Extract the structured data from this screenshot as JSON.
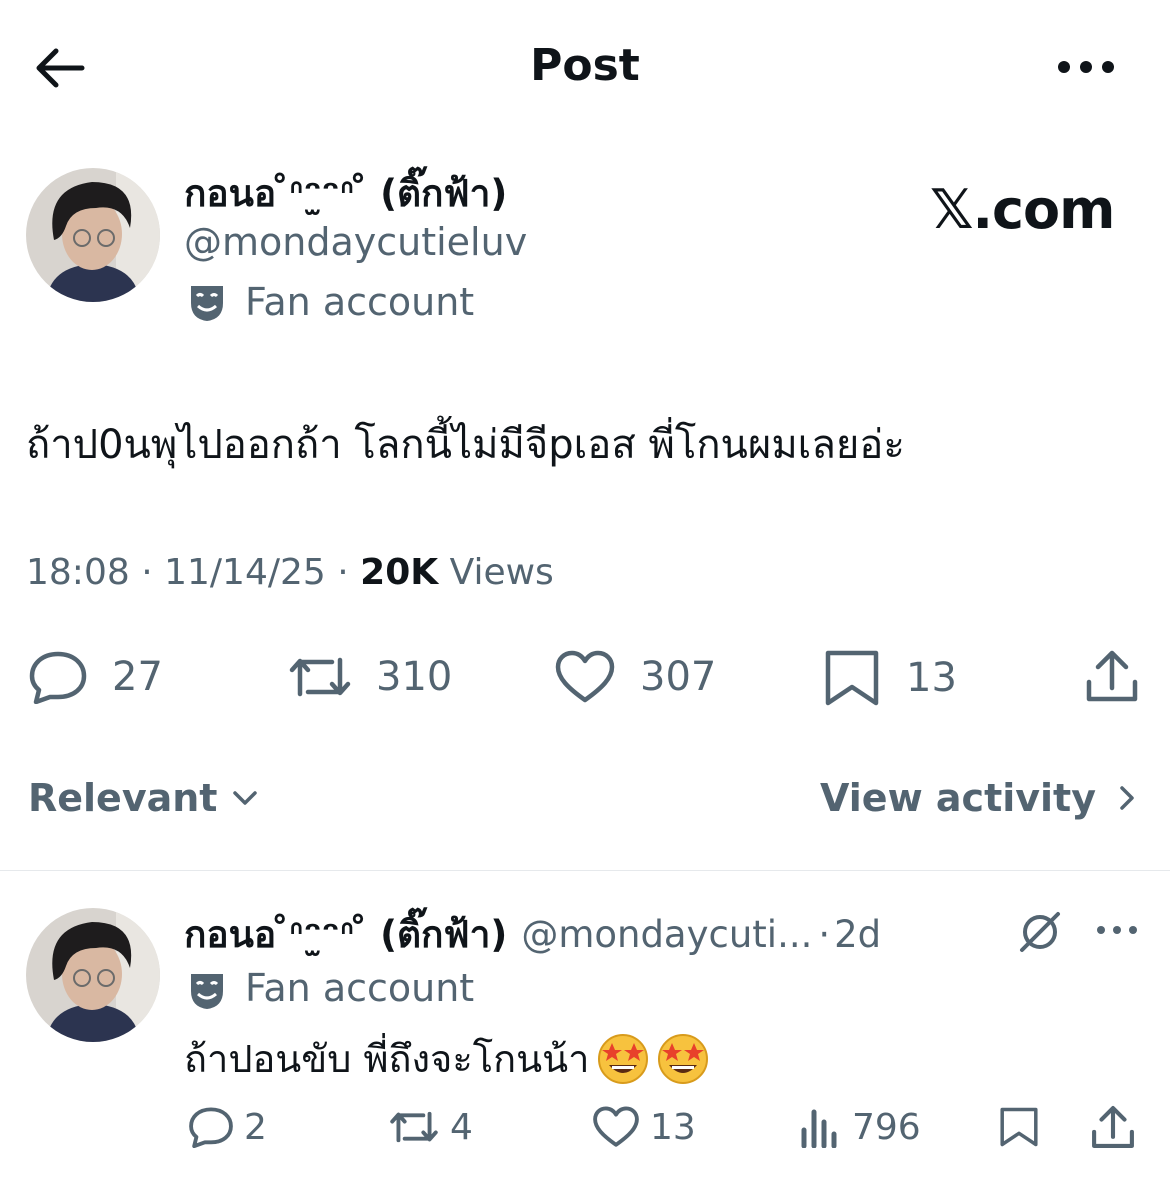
{
  "header": {
    "title": "Post"
  },
  "post": {
    "display_name": "กอนอ ̊ᐢ⁠ᵔ⁠̫⁠ᵔ⁠ᐢ ̊ (ติ๊กฟ้า)",
    "handle": "@mondaycutieluv",
    "label": "Fan account",
    "watermark": "𝕏.com",
    "text": "ถ้าป0นพุไปออกถ้า โลกนี้ไม่มีจีpเอส พี่โกนผมเลยอ่ะ",
    "time": "18:08",
    "date": "11/14/25",
    "views_count": "20K",
    "views_label": "Views",
    "separator": "·",
    "stats": {
      "replies": "27",
      "reposts": "310",
      "likes": "307",
      "bookmarks": "13"
    }
  },
  "replies_bar": {
    "sort_label": "Relevant",
    "activity_label": "View activity"
  },
  "reply": {
    "display_name": "กอนอ ̊ᐢ⁠ᵔ⁠̫⁠ᵔ⁠ᐢ ̊ (ติ๊กฟ้า)",
    "handle": "@mondaycuti...",
    "separator": "·",
    "age": "2d",
    "label": "Fan account",
    "text": "ถ้าปอนขับ พี่ถึงจะโกนน้า",
    "stats": {
      "replies": "2",
      "reposts": "4",
      "likes": "13",
      "views": "796"
    }
  },
  "colors": {
    "text": "#0f1419",
    "secondary": "#536471",
    "divider": "#e6e9ec"
  },
  "icons": [
    "back-arrow-icon",
    "more-icon",
    "theater-mask-icon",
    "reply-icon",
    "repost-icon",
    "like-icon",
    "bookmark-icon",
    "share-icon",
    "chevron-down-icon",
    "chevron-right-icon",
    "mute-icon",
    "views-icon",
    "star-struck-emoji-icon"
  ]
}
